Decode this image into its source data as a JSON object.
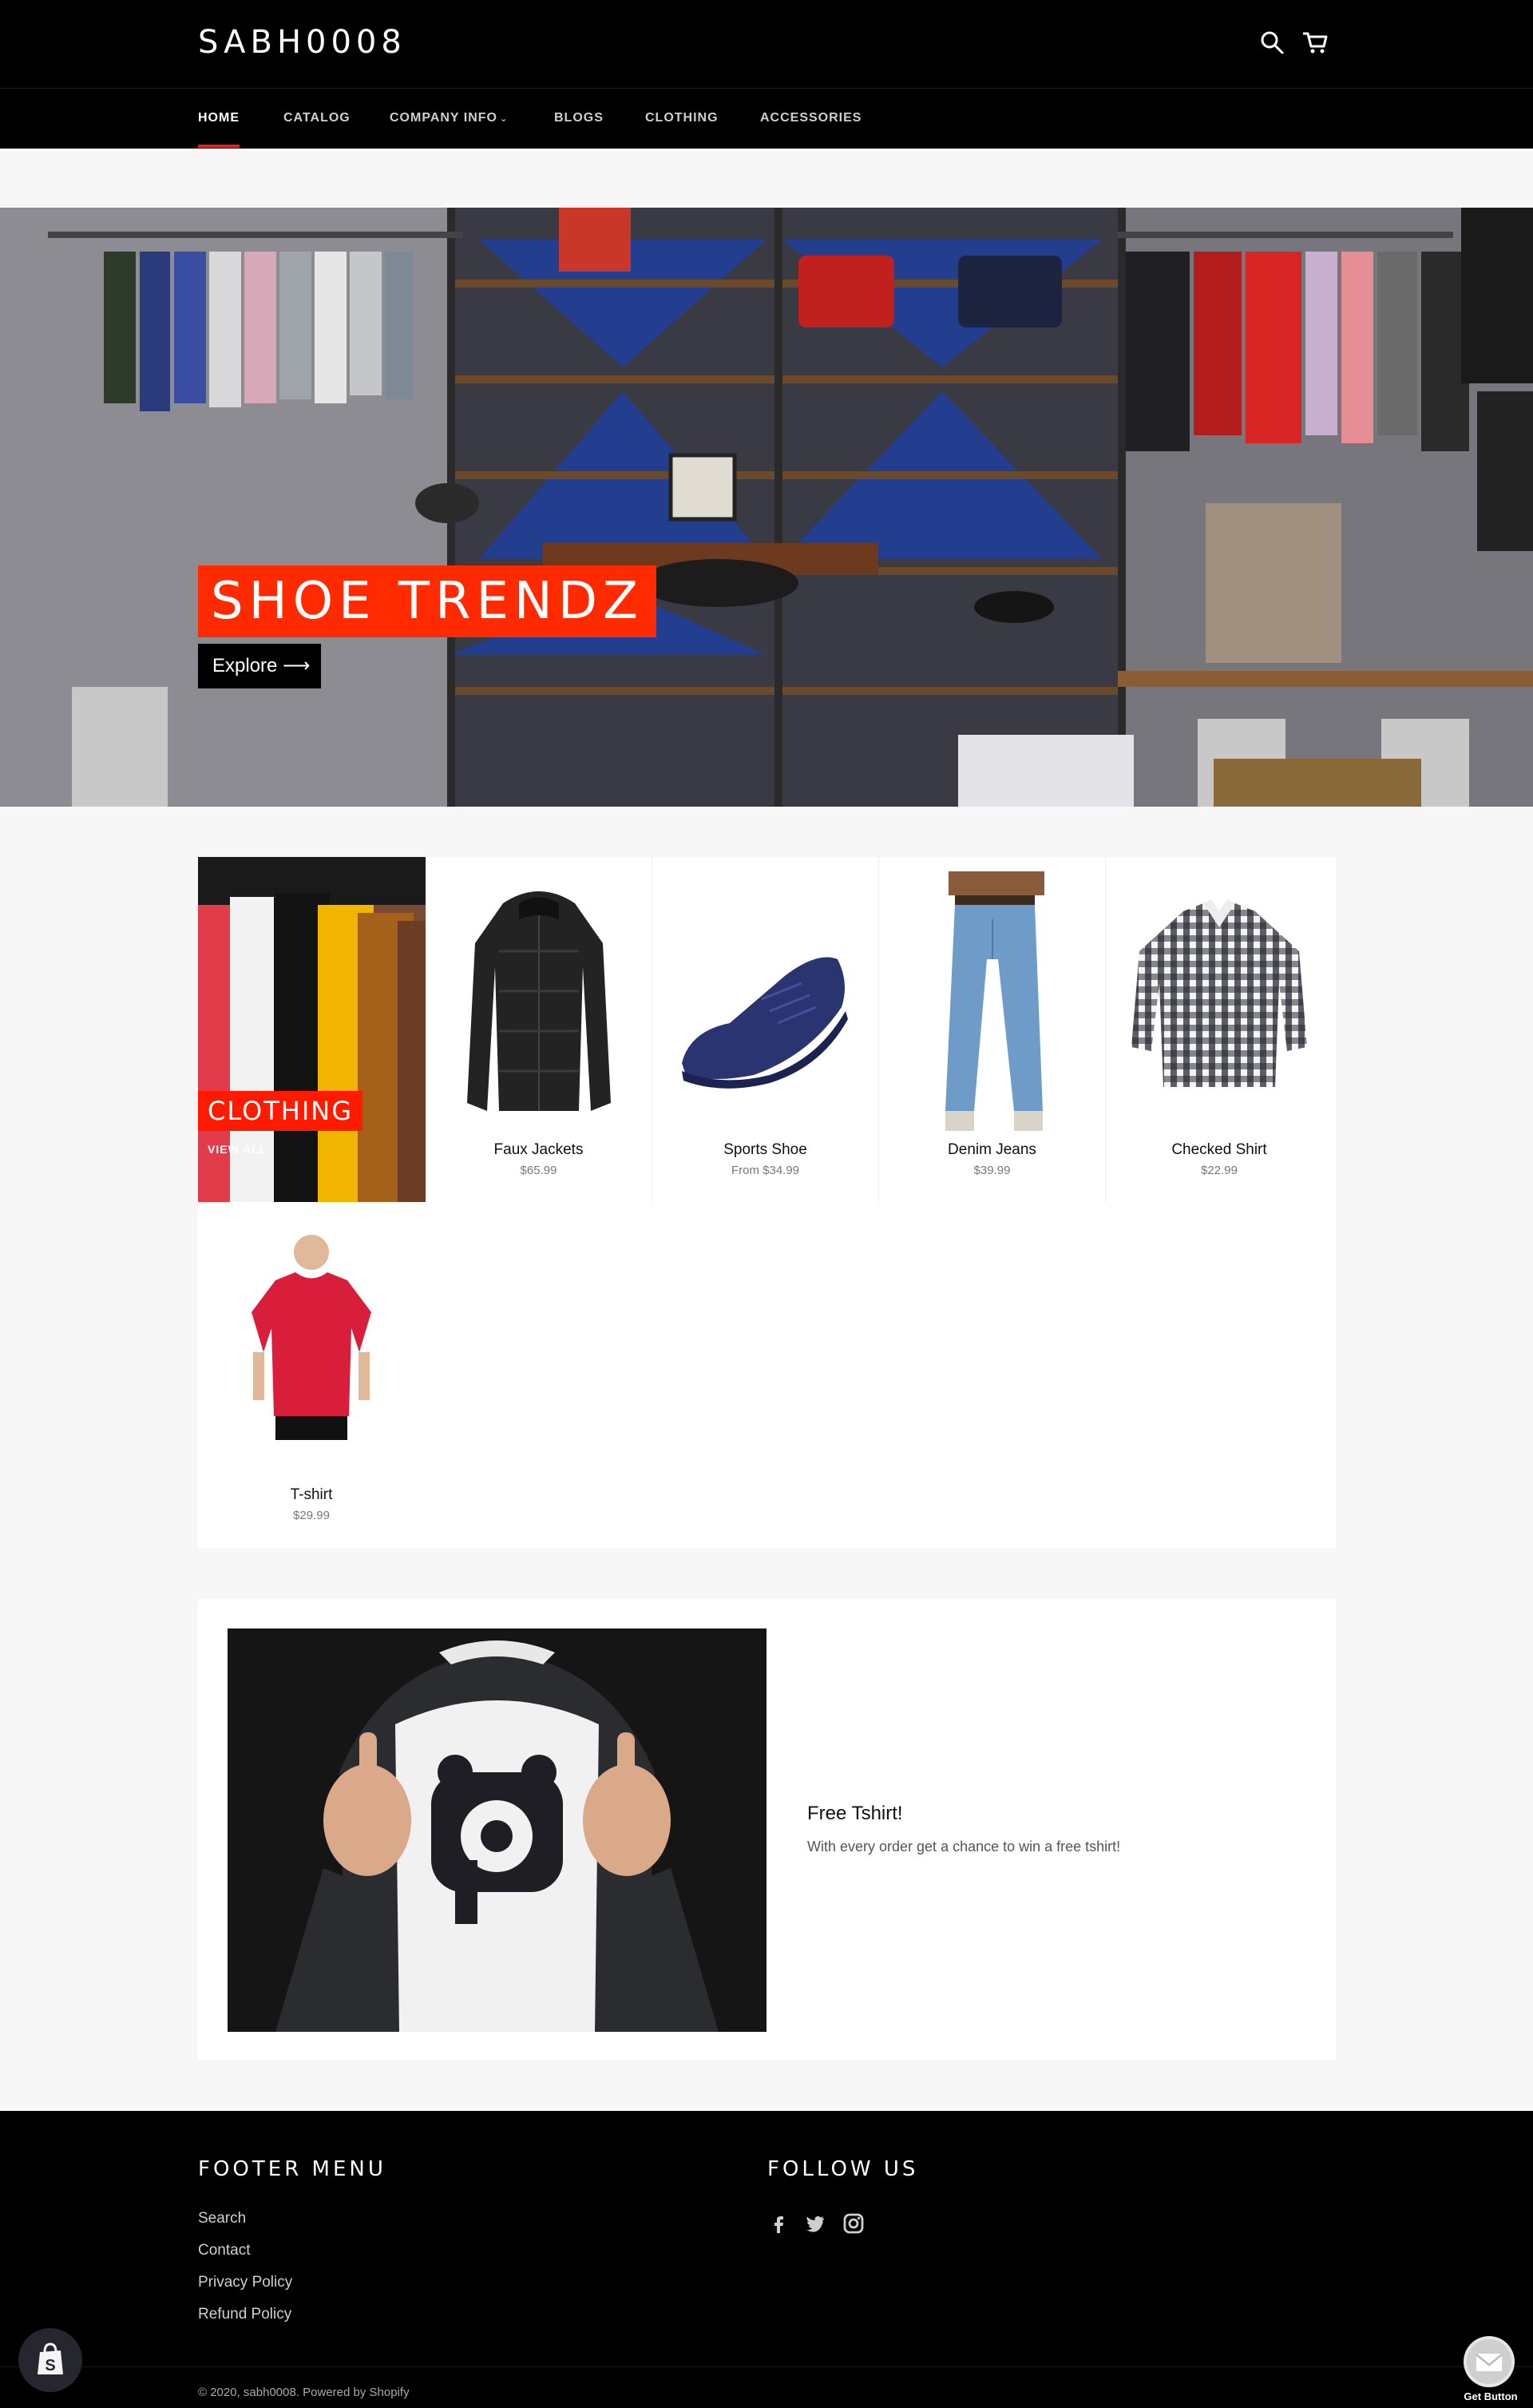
{
  "header": {
    "logo": "SABH0008",
    "icons": [
      "search-icon",
      "cart-icon"
    ]
  },
  "nav": {
    "items": [
      {
        "label": "HOME",
        "active": true
      },
      {
        "label": "CATALOG"
      },
      {
        "label": "COMPANY INFO"
      },
      {
        "label": "BLOGS"
      },
      {
        "label": "CLOTHING"
      },
      {
        "label": "ACCESSORIES"
      }
    ],
    "accent": "#e3201b"
  },
  "hero": {
    "title": "SHOE TRENDZ",
    "button_label": "Explore ⟶",
    "title_bg": "#ff2a00"
  },
  "collection": {
    "title": "CLOTHING",
    "view_all": "VIEW ALL",
    "products": [
      {
        "name": "Faux Jackets",
        "price": "$65.99"
      },
      {
        "name": "Sports Shoe",
        "price": "From $34.99"
      },
      {
        "name": "Denim Jeans",
        "price": "$39.99"
      },
      {
        "name": "Checked Shirt",
        "price": "$22.99"
      },
      {
        "name": "T-shirt",
        "price": "$29.99"
      }
    ]
  },
  "feature": {
    "title": "Free Tshirt!",
    "text": "With every order get a chance to win a free tshirt!"
  },
  "footer": {
    "menu_title": "FOOTER MENU",
    "links": [
      "Search",
      "Contact",
      "Privacy Policy",
      "Refund Policy"
    ],
    "follow_title": "FOLLOW US",
    "social": [
      "facebook-icon",
      "twitter-icon",
      "instagram-icon"
    ],
    "copyright": "© 2020, sabh0008. Powered by Shopify",
    "get_button_label": "Get Button"
  }
}
